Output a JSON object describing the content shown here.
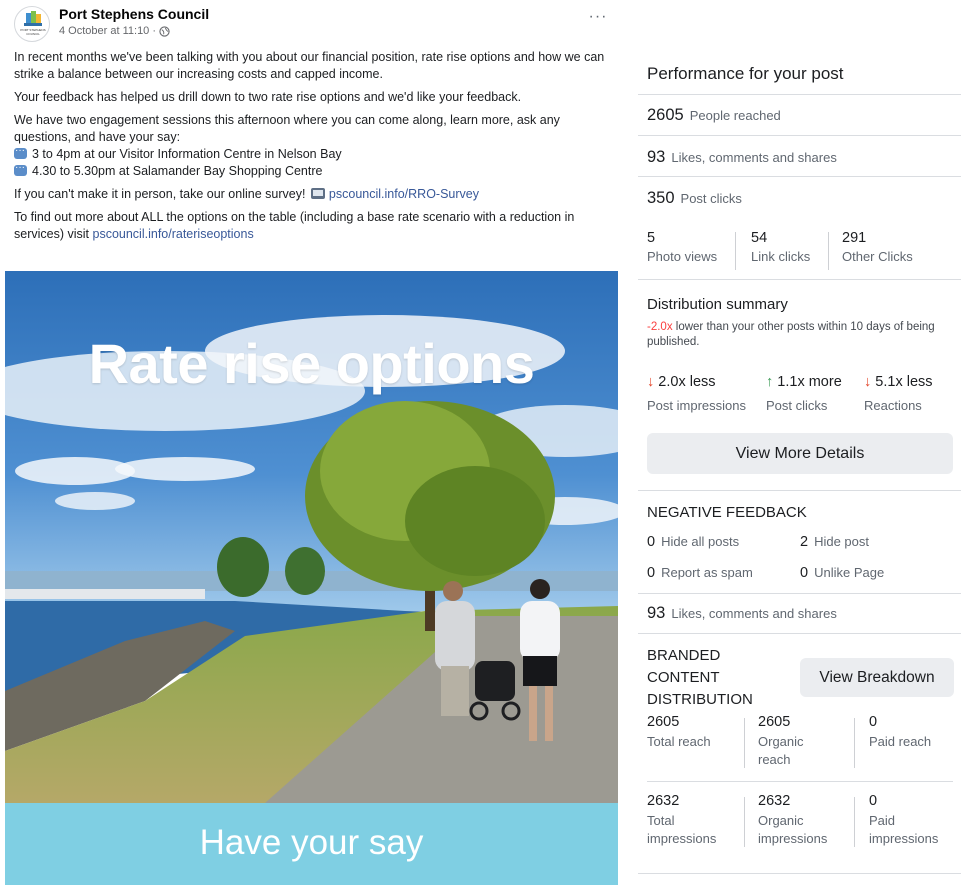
{
  "post": {
    "author": "Port Stephens Council",
    "timestamp": "4 October at 11:10 ·",
    "avatar_text": "PORT STEPHENS COUNCIL",
    "more_label": "···",
    "paragraphs": {
      "p1": "In recent months we've been talking with you about our financial position, rate rise options and how we can strike a balance between our increasing costs and capped income.",
      "p2": "Your feedback has helped us drill down to two rate rise options and we'd like your feedback.",
      "p3": "We have two engagement sessions this afternoon where you can come along, learn more, ask any questions, and have your say:",
      "session1": "3 to 4pm at our Visitor Information Centre in Nelson Bay",
      "session2": "4.30 to 5.30pm at Salamander Bay Shopping Centre",
      "survey_text": "If you can't make it in person, take our online survey!",
      "survey_link": "pscouncil.info/RRO-Survey",
      "more_text": "To find out more about ALL the options on the table (including a base rate scenario with a reduction in services) visit",
      "more_link": "pscouncil.info/rateriseoptions"
    },
    "image": {
      "title": "Rate rise options",
      "subtitle": "Have your say"
    }
  },
  "insights": {
    "title": "Performance for your post",
    "people_reached": {
      "value": "2605",
      "label": "People reached"
    },
    "engagement": {
      "value": "93",
      "label": "Likes, comments and shares"
    },
    "post_clicks": {
      "value": "350",
      "label": "Post clicks"
    },
    "clicks_breakdown": [
      {
        "value": "5",
        "label": "Photo views"
      },
      {
        "value": "54",
        "label": "Link clicks"
      },
      {
        "value": "291",
        "label": "Other Clicks"
      }
    ],
    "distribution": {
      "title": "Distribution summary",
      "multiplier": "-2.0x",
      "description": "lower than your other posts within 10 days of being published.",
      "items": [
        {
          "arrow": "↓",
          "value": "2.0x less",
          "label": "Post impressions",
          "direction": "down"
        },
        {
          "arrow": "↑",
          "value": "1.1x more",
          "label": "Post clicks",
          "direction": "up"
        },
        {
          "arrow": "↓",
          "value": "5.1x less",
          "label": "Reactions",
          "direction": "down"
        }
      ],
      "button": "View More Details"
    },
    "negative_feedback": {
      "title": "NEGATIVE FEEDBACK",
      "items": [
        {
          "value": "0",
          "label": "Hide all posts"
        },
        {
          "value": "2",
          "label": "Hide post"
        },
        {
          "value": "0",
          "label": "Report as spam"
        },
        {
          "value": "0",
          "label": "Unlike Page"
        }
      ]
    },
    "engagement2": {
      "value": "93",
      "label": "Likes, comments and shares"
    },
    "branded": {
      "title": "BRANDED CONTENT DISTRIBUTION",
      "button": "View Breakdown",
      "reach": [
        {
          "value": "2605",
          "label": "Total reach"
        },
        {
          "value": "2605",
          "label": "Organic reach"
        },
        {
          "value": "0",
          "label": "Paid reach"
        }
      ],
      "impressions": [
        {
          "value": "2632",
          "label": "Total impressions"
        },
        {
          "value": "2632",
          "label": "Organic impressions"
        },
        {
          "value": "0",
          "label": "Paid impressions"
        }
      ]
    },
    "colors": {
      "negative": "#fa3e3e",
      "down_arrow": "#e4492f",
      "up_arrow": "#3e9b58",
      "link": "#385898"
    }
  }
}
